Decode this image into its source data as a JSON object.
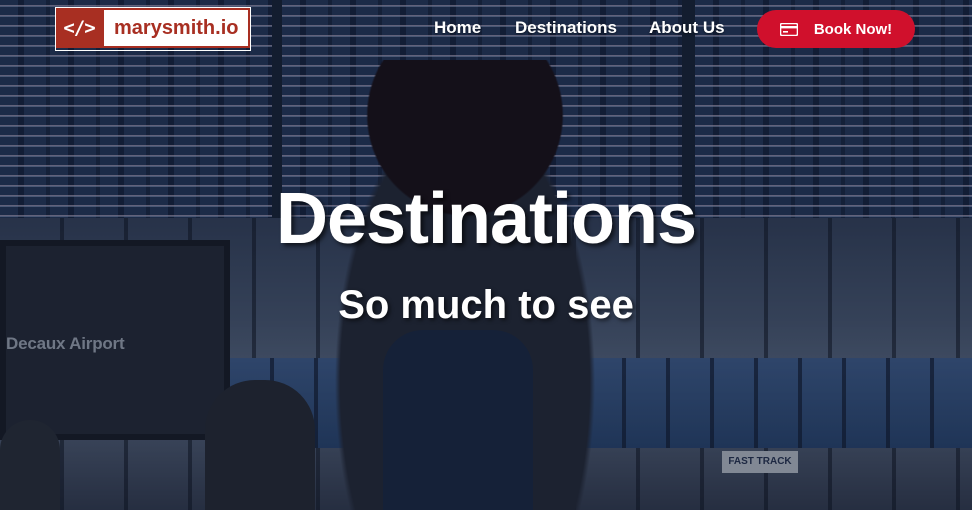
{
  "brand": {
    "icon": "code-brackets-icon",
    "mark": "</>",
    "name": "marysmith.io",
    "color": "#a82f22"
  },
  "nav": {
    "items": [
      {
        "label": "Home"
      },
      {
        "label": "Destinations"
      },
      {
        "label": "About Us"
      }
    ],
    "cta": {
      "label": "Book Now!",
      "icon": "credit-card-icon",
      "color": "#d0102c"
    }
  },
  "hero": {
    "title": "Destinations",
    "subtitle": "So much to see"
  },
  "background": {
    "screen_label": "Decaux Airport",
    "sign_text": "FAST TRACK"
  }
}
